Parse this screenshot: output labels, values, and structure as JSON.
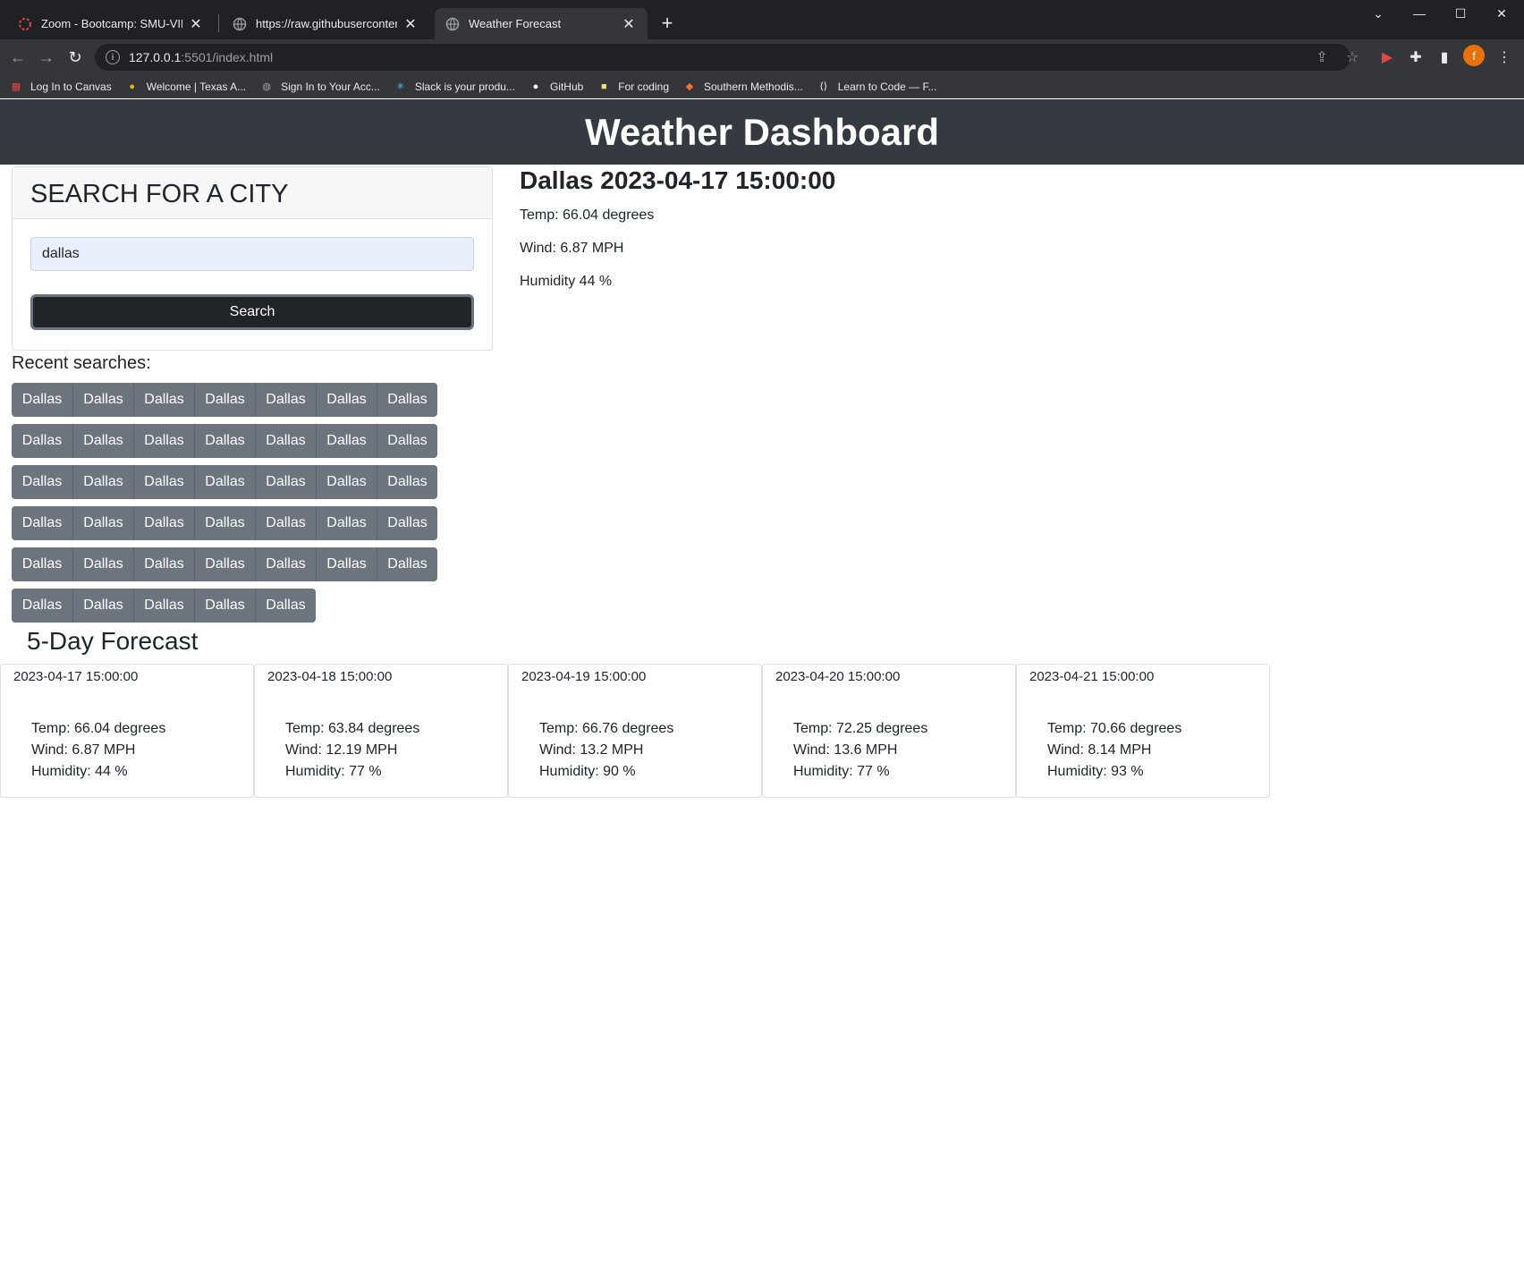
{
  "browser": {
    "tabs": [
      {
        "title": "Zoom - Bootcamp: SMU-VIRT-FS",
        "active": false
      },
      {
        "title": "https://raw.githubusercontent.co",
        "active": false
      },
      {
        "title": "Weather Forecast",
        "active": true
      }
    ],
    "url_host": "127.0.0.1",
    "url_path": ":5501/index.html",
    "avatar_letter": "f",
    "bookmarks": [
      "Log In to Canvas",
      "Welcome | Texas A...",
      "Sign In to Your Acc...",
      "Slack is your produ...",
      "GitHub",
      "For coding",
      "Southern Methodis...",
      "Learn to Code — F..."
    ]
  },
  "page": {
    "header_title": "Weather Dashboard",
    "search": {
      "card_title": "SEARCH FOR A CITY",
      "input_value": "dallas",
      "button_label": "Search"
    },
    "recent": {
      "label": "Recent searches:",
      "rows": [
        [
          "Dallas",
          "Dallas",
          "Dallas",
          "Dallas",
          "Dallas",
          "Dallas",
          "Dallas"
        ],
        [
          "Dallas",
          "Dallas",
          "Dallas",
          "Dallas",
          "Dallas",
          "Dallas",
          "Dallas"
        ],
        [
          "Dallas",
          "Dallas",
          "Dallas",
          "Dallas",
          "Dallas",
          "Dallas",
          "Dallas"
        ],
        [
          "Dallas",
          "Dallas",
          "Dallas",
          "Dallas",
          "Dallas",
          "Dallas",
          "Dallas"
        ],
        [
          "Dallas",
          "Dallas",
          "Dallas",
          "Dallas",
          "Dallas",
          "Dallas",
          "Dallas"
        ],
        [
          "Dallas",
          "Dallas",
          "Dallas",
          "Dallas",
          "Dallas"
        ]
      ]
    },
    "current": {
      "heading": "Dallas 2023-04-17 15:00:00",
      "temp": "Temp: 66.04 degrees",
      "wind": "Wind: 6.87 MPH",
      "humidity": "Humidity 44 %"
    },
    "forecast": {
      "title": "5-Day Forecast",
      "days": [
        {
          "date": "2023-04-17 15:00:00",
          "temp": "Temp: 66.04 degrees",
          "wind": "Wind: 6.87 MPH",
          "humidity": "Humidity: 44 %"
        },
        {
          "date": "2023-04-18 15:00:00",
          "temp": "Temp: 63.84 degrees",
          "wind": "Wind: 12.19 MPH",
          "humidity": "Humidity: 77 %"
        },
        {
          "date": "2023-04-19 15:00:00",
          "temp": "Temp: 66.76 degrees",
          "wind": "Wind: 13.2 MPH",
          "humidity": "Humidity: 90 %"
        },
        {
          "date": "2023-04-20 15:00:00",
          "temp": "Temp: 72.25 degrees",
          "wind": "Wind: 13.6 MPH",
          "humidity": "Humidity: 77 %"
        },
        {
          "date": "2023-04-21 15:00:00",
          "temp": "Temp: 70.66 degrees",
          "wind": "Wind: 8.14 MPH",
          "humidity": "Humidity: 93 %"
        }
      ]
    }
  },
  "colors": {
    "header_bg": "#343a40",
    "city_button": "#6c757d",
    "search_button": "#212529",
    "input_bg": "#e8f0fe"
  }
}
